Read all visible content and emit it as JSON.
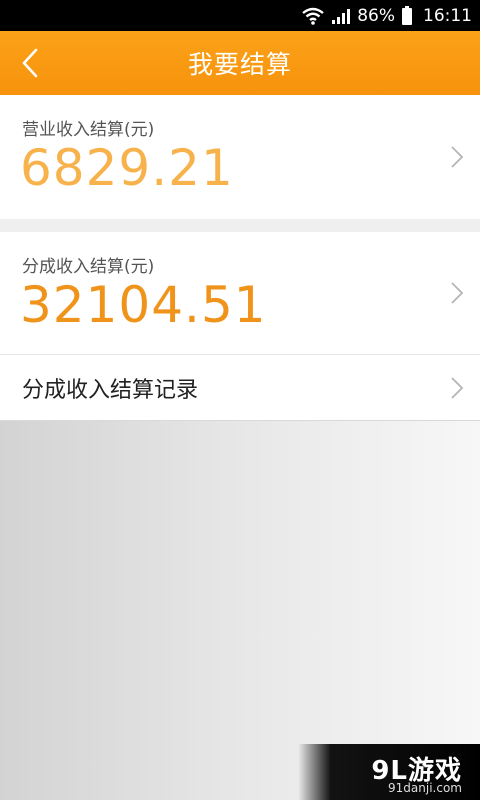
{
  "status_bar": {
    "battery_percent": "86%",
    "time": "16:11",
    "icons": [
      "wifi-icon",
      "signal-icon",
      "battery-icon"
    ]
  },
  "header": {
    "title": "我要结算",
    "back_icon": "chevron-left-icon",
    "bg_color": "#f7920c"
  },
  "settlements": [
    {
      "label": "营业收入结算(元)",
      "amount": "6829.21",
      "color": "#f7b24c"
    },
    {
      "label": "分成收入结算(元)",
      "amount": "32104.51",
      "color": "#f0931a"
    }
  ],
  "records_link": {
    "label": "分成收入结算记录"
  },
  "watermark": {
    "logo": "9L游戏",
    "url": "91danji.com"
  }
}
